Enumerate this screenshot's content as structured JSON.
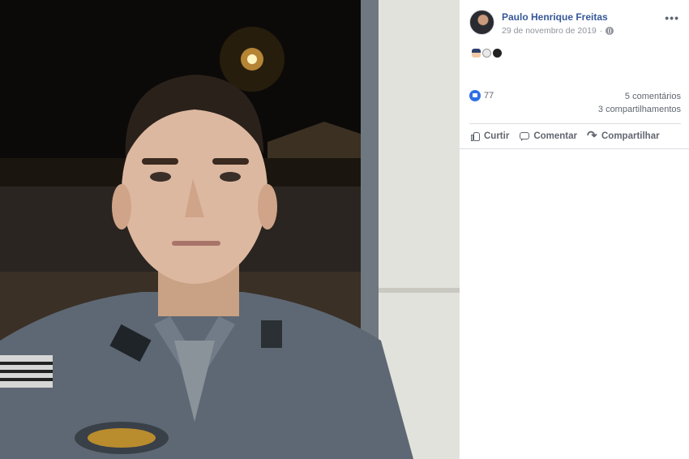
{
  "post": {
    "author": "Paulo Henrique Freitas",
    "date": "29 de novembro de 2019",
    "more_label": "•••",
    "privacy_icon": "globe-icon",
    "text_emojis": [
      "police-officer-emoji",
      "skull-emoji",
      "bomb-emoji"
    ]
  },
  "stats": {
    "likes": "77",
    "comments": "5 comentários",
    "shares": "3 compartilhamentos"
  },
  "actions": {
    "like": "Curtir",
    "comment": "Comentar",
    "share": "Compartilhar"
  },
  "colors": {
    "author_link": "#365899",
    "meta_text": "#90949c",
    "action_text": "#606770",
    "like_badge": "#2e6fe6"
  }
}
